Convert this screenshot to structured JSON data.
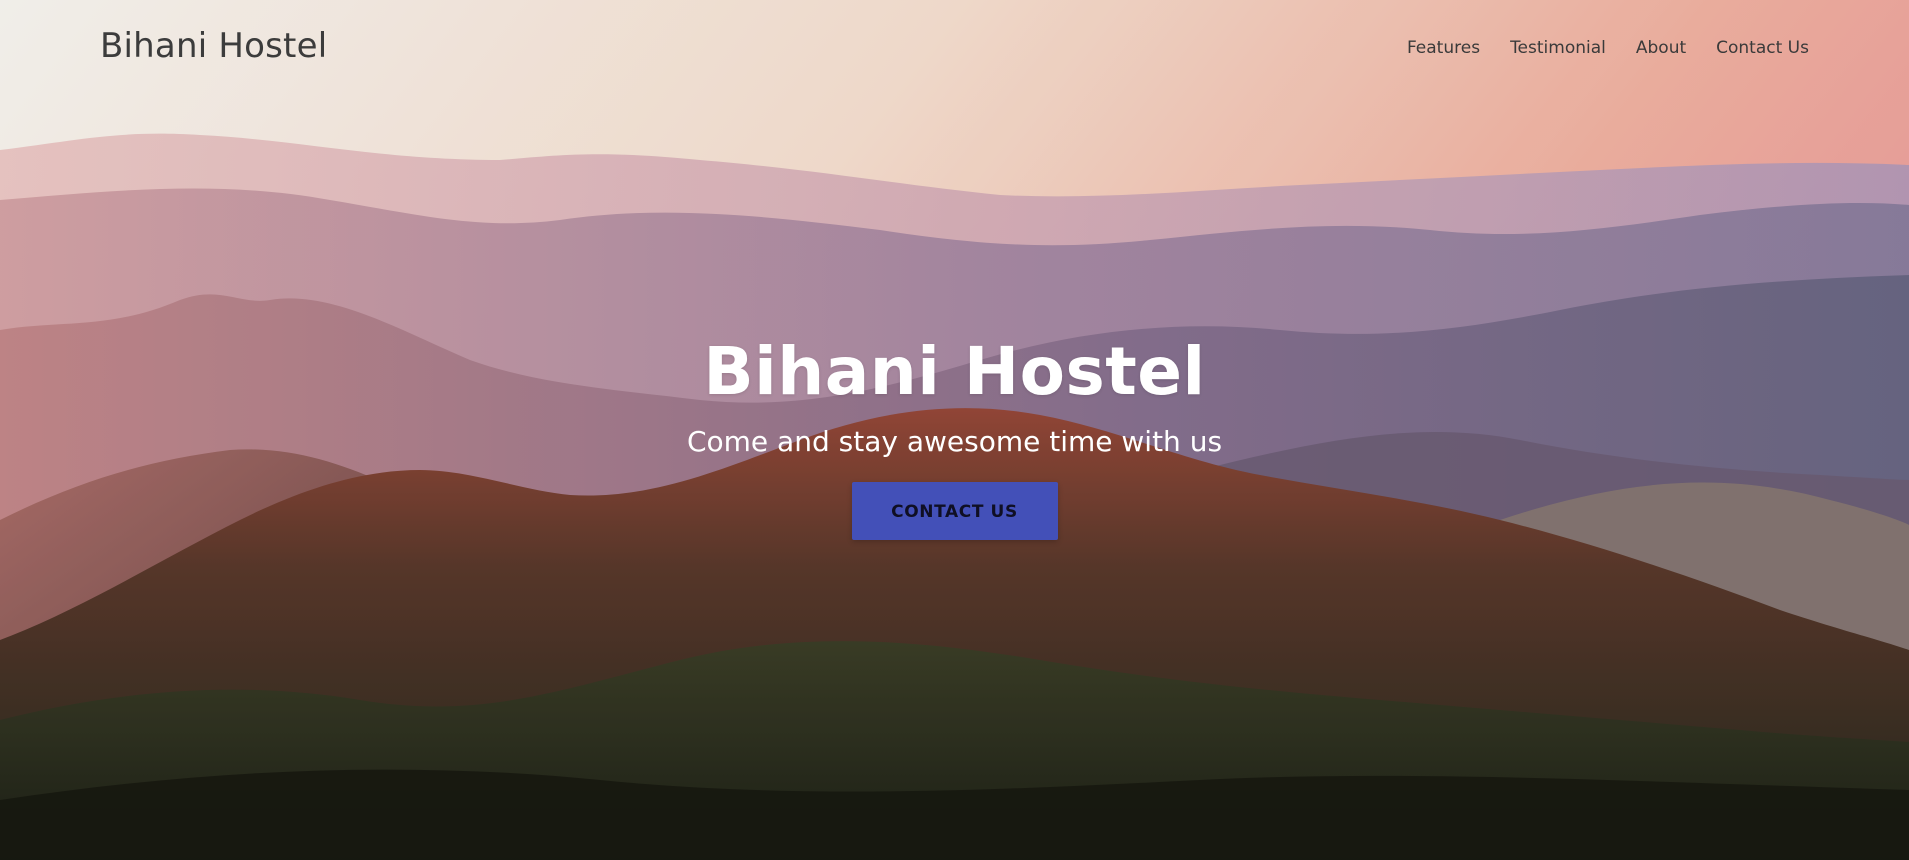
{
  "nav": {
    "brand": "Bihani Hostel",
    "links": [
      {
        "label": "Features"
      },
      {
        "label": "Testimonial"
      },
      {
        "label": "About"
      },
      {
        "label": "Contact Us"
      }
    ]
  },
  "hero": {
    "title": "Bihani Hostel",
    "subtitle": "Come and stay awesome time with us",
    "cta_label": "CONTACT US",
    "background": "mountain-landscape-at-sunset"
  },
  "colors": {
    "cta_background": "#4350b8",
    "hero_text": "#ffffff",
    "nav_text": "#3a3a3a"
  }
}
